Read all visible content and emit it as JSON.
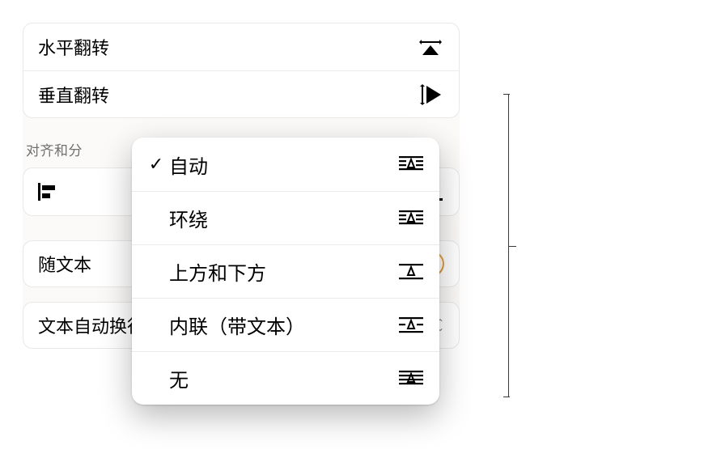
{
  "topCard": {
    "flip_horizontal": "水平翻转",
    "flip_vertical": "垂直翻转"
  },
  "sectionHeader": "对齐和分",
  "moveWithText": {
    "label": "随文本",
    "on": true
  },
  "textWrap": {
    "label": "文本自动换行",
    "value": "自动"
  },
  "popup": {
    "items": [
      {
        "label": "自动",
        "kind": "auto",
        "selected": true
      },
      {
        "label": "环绕",
        "kind": "around",
        "selected": false
      },
      {
        "label": "上方和下方",
        "kind": "above_below",
        "selected": false
      },
      {
        "label": "内联（带文本）",
        "kind": "inline",
        "selected": false
      },
      {
        "label": "无",
        "kind": "none",
        "selected": false
      }
    ]
  }
}
